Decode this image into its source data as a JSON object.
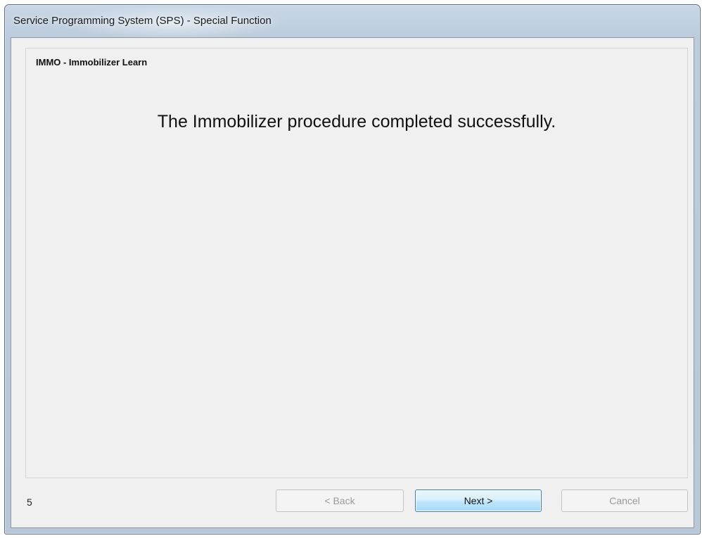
{
  "window": {
    "title": "Service Programming System (SPS) - Special Function"
  },
  "panel": {
    "group_title": "IMMO - Immobilizer Learn",
    "message": "The Immobilizer procedure completed successfully."
  },
  "footer": {
    "step_number": "5",
    "back_label": "< Back",
    "next_label": "Next >",
    "cancel_label": "Cancel",
    "back_enabled": false,
    "next_enabled": true,
    "cancel_enabled": false
  },
  "colors": {
    "titlebar": "#c9d7e6",
    "client_background": "#f0f0f0",
    "next_button_border": "#3c7fb1",
    "disabled_text": "#9a9a9a"
  }
}
